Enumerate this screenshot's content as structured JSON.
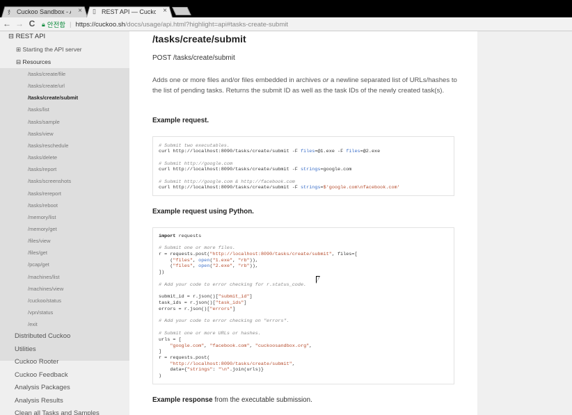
{
  "browser": {
    "tabs": [
      {
        "label": "Cuckoo Sandbox - Auto",
        "close": "×"
      },
      {
        "label": "REST API — Cuckoo Sa",
        "close": "×"
      }
    ],
    "nav": {
      "back": "←",
      "forward": "→",
      "reload": "C"
    },
    "url": {
      "security_label": "안전함",
      "separator": "|",
      "host": "https://cuckoo.sh",
      "path": "/docs/usage/api.html?highlight=api#tasks-create-submit"
    }
  },
  "sidebar": {
    "section": "⊟ REST API",
    "starting": "⊞ Starting the API server",
    "resources": "⊟ Resources",
    "items": [
      "/tasks/create/file",
      "/tasks/create/url",
      "/tasks/create/submit",
      "/tasks/list",
      "/tasks/sample",
      "/tasks/view",
      "/tasks/reschedule",
      "/tasks/delete",
      "/tasks/report",
      "/tasks/screenshots",
      "/tasks/rereport",
      "/tasks/reboot",
      "/memory/list",
      "/memory/get",
      "/files/view",
      "/files/get",
      "/pcap/get",
      "/machines/list",
      "/machines/view",
      "/cuckoo/status",
      "/vpn/status",
      "/exit"
    ],
    "current_index": 2,
    "lower": [
      "Distributed Cuckoo",
      "Utilities",
      "Cuckoo Rooter",
      "Cuckoo Feedback",
      "Analysis Packages",
      "Analysis Results",
      "Clean all Tasks and Samples"
    ]
  },
  "main": {
    "title": "/tasks/create/submit",
    "subtitle": "POST /tasks/create/submit",
    "desc_1": "Adds one or more files and/or files embedded in archives ",
    "desc_or": "or",
    "desc_2": " a newline separated list of URLs/hashes to the list of pending tasks. Returns the submit ID as well as the task IDs of the newly created task(s).",
    "example_request": "Example request.",
    "example_python": "Example request using Python.",
    "example_response_bold": "Example response",
    "example_response_rest": " from the executable submission."
  },
  "curl_code": [
    {
      "c": "# Submit two executables."
    },
    {
      "t": "curl http://localhost:8090/tasks/create/submit -F ",
      "a": "files",
      "b": "=@1.exe -F ",
      "a2": "files",
      "b2": "=@2.exe"
    },
    {
      "c": "# Submit http://google.com"
    },
    {
      "t": "curl http://localhost:8090/tasks/create/submit -F ",
      "a": "strings",
      "b": "=google.com"
    },
    {
      "c": "# Submit http://google.com & http://facebook.com"
    },
    {
      "t": "curl http://localhost:8090/tasks/create/submit -F ",
      "a": "strings",
      "b": "=",
      "s": "$'google.com\\nfacebook.com'"
    }
  ],
  "python_code": {
    "l1_kw": "import",
    "l1_rest": " requests",
    "l2": "# Submit one or more files.",
    "l3_a": "r = requests.post(",
    "l3_s": "\"http://localhost:8090/tasks/create/submit\"",
    "l3_b": ", files=[",
    "l4_a": "    (",
    "l4_s1": "\"files\"",
    "l4_b": ", ",
    "l4_o": "open",
    "l4_c": "(",
    "l4_s2": "\"1.exe\"",
    "l4_d": ", ",
    "l4_s3": "\"rb\"",
    "l4_e": ")),",
    "l5_a": "    (",
    "l5_s1": "\"files\"",
    "l5_b": ", ",
    "l5_o": "open",
    "l5_c": "(",
    "l5_s2": "\"2.exe\"",
    "l5_d": ", ",
    "l5_s3": "\"rb\"",
    "l5_e": ")),",
    "l6": "])",
    "l7": "# Add your code to error checking for r.status_code.",
    "l8_a": "submit_id = r.json()[",
    "l8_s": "\"submit_id\"",
    "l8_b": "]",
    "l9_a": "task_ids = r.json()[",
    "l9_s": "\"task_ids\"",
    "l9_b": "]",
    "l10_a": "errors = r.json()[",
    "l10_s": "\"errors\"",
    "l10_b": "]",
    "l11": "# Add your code to error checking on \"errors\".",
    "l12": "# Submit one or more URLs or hashes.",
    "l13": "urls = [",
    "l14_a": "    ",
    "l14_s1": "\"google.com\"",
    "l14_b": ", ",
    "l14_s2": "\"facebook.com\"",
    "l14_c": ", ",
    "l14_s3": "\"cuckoosandbox.org\"",
    "l14_d": ",",
    "l15": "]",
    "l16": "r = requests.post(",
    "l17_a": "    ",
    "l17_s": "\"http://localhost:8090/tasks/create/submit\"",
    "l17_b": ",",
    "l18_a": "    data={",
    "l18_s1": "\"strings\"",
    "l18_b": ": ",
    "l18_s2": "\"\\n\"",
    "l18_c": ".join(urls)}",
    "l19": ")"
  }
}
